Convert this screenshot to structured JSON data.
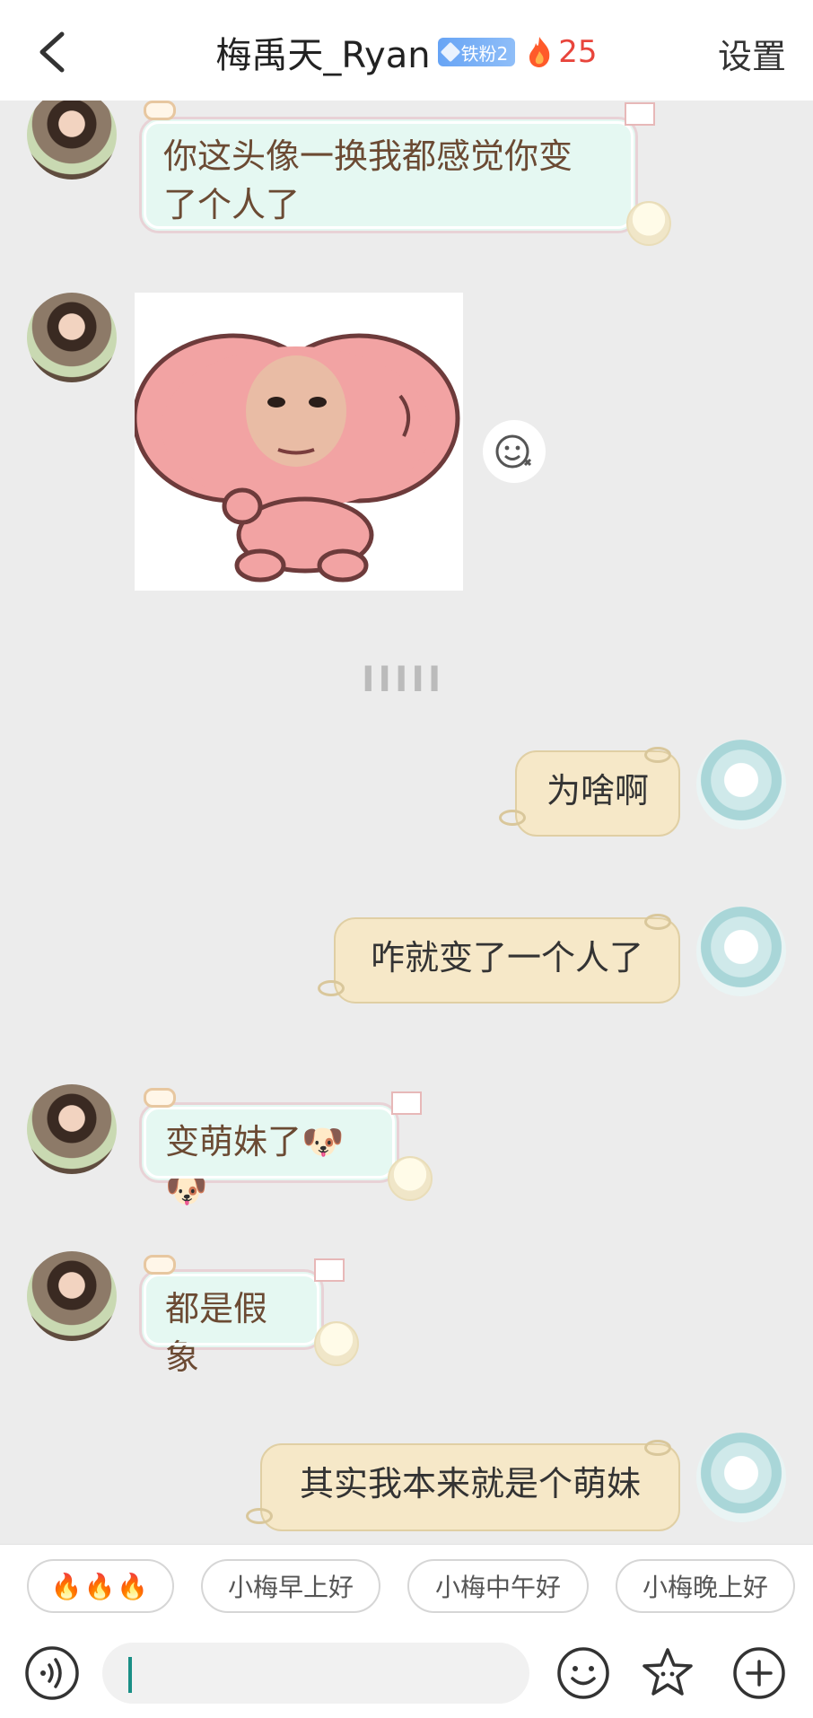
{
  "header": {
    "title": "梅禹天_Ryan",
    "fan_badge": "铁粉2",
    "flame_count": "25",
    "settings_label": "设置",
    "back_icon": "chevron-left-icon"
  },
  "messages": [
    {
      "side": "in",
      "text_line1": "你这头像一换我都感觉你变",
      "text_line2": "了个人了"
    },
    {
      "side": "in",
      "type": "sticker"
    },
    {
      "side": "out",
      "text": "为啥啊"
    },
    {
      "side": "out",
      "text": "咋就变了一个人了"
    },
    {
      "side": "in",
      "text": "变萌妹了",
      "emojis": "🐶🐶"
    },
    {
      "side": "in",
      "text": "都是假象"
    },
    {
      "side": "out",
      "text": "其实我本来就是个萌妹"
    }
  ],
  "quick_replies": [
    "🔥🔥🔥",
    "小梅早上好",
    "小梅中午好",
    "小梅晚上好"
  ],
  "input": {
    "value": "",
    "placeholder": ""
  },
  "colors": {
    "incoming_bubble": "#e5f8f2",
    "outgoing_bubble": "#f6e8c8",
    "incoming_text": "#6b4a33",
    "flame": "#e8453c",
    "badge": "#67a4f5",
    "caret": "#1a8f86"
  }
}
